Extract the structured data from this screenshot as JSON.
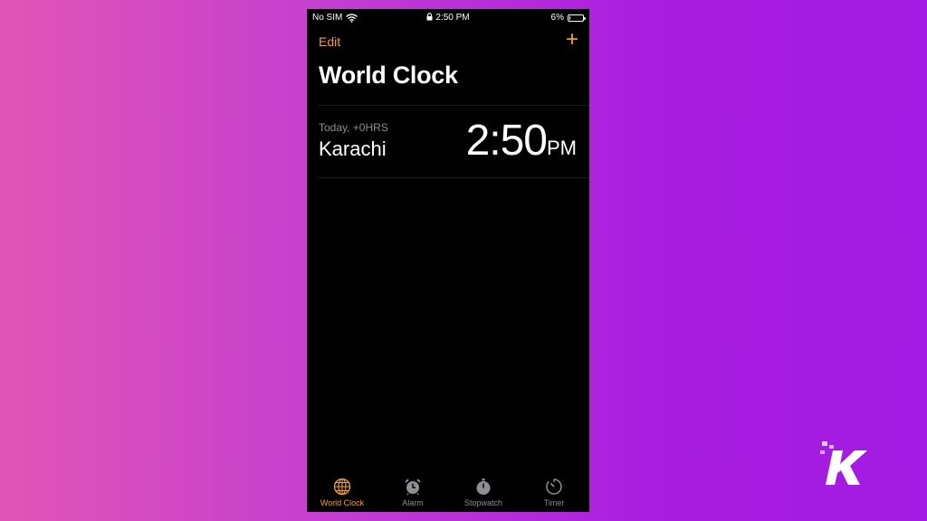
{
  "status_bar": {
    "carrier": "No SIM",
    "time": "2:50 PM",
    "battery": "6%",
    "battery_level": 0.06
  },
  "nav": {
    "edit_label": "Edit",
    "add_label": "+"
  },
  "title": "World Clock",
  "clocks": [
    {
      "offset": "Today, +0HRS",
      "city": "Karachi",
      "time": "2:50",
      "ampm": "PM"
    }
  ],
  "tabs": [
    {
      "label": "World Clock",
      "icon": "globe-icon",
      "active": true
    },
    {
      "label": "Alarm",
      "icon": "alarm-clock-icon",
      "active": false
    },
    {
      "label": "Stopwatch",
      "icon": "stopwatch-icon",
      "active": false
    },
    {
      "label": "Timer",
      "icon": "timer-icon",
      "active": false
    }
  ],
  "colors": {
    "accent": "#f0a030",
    "inactive": "#8e8e93",
    "background": "#000000"
  },
  "watermark": "K"
}
